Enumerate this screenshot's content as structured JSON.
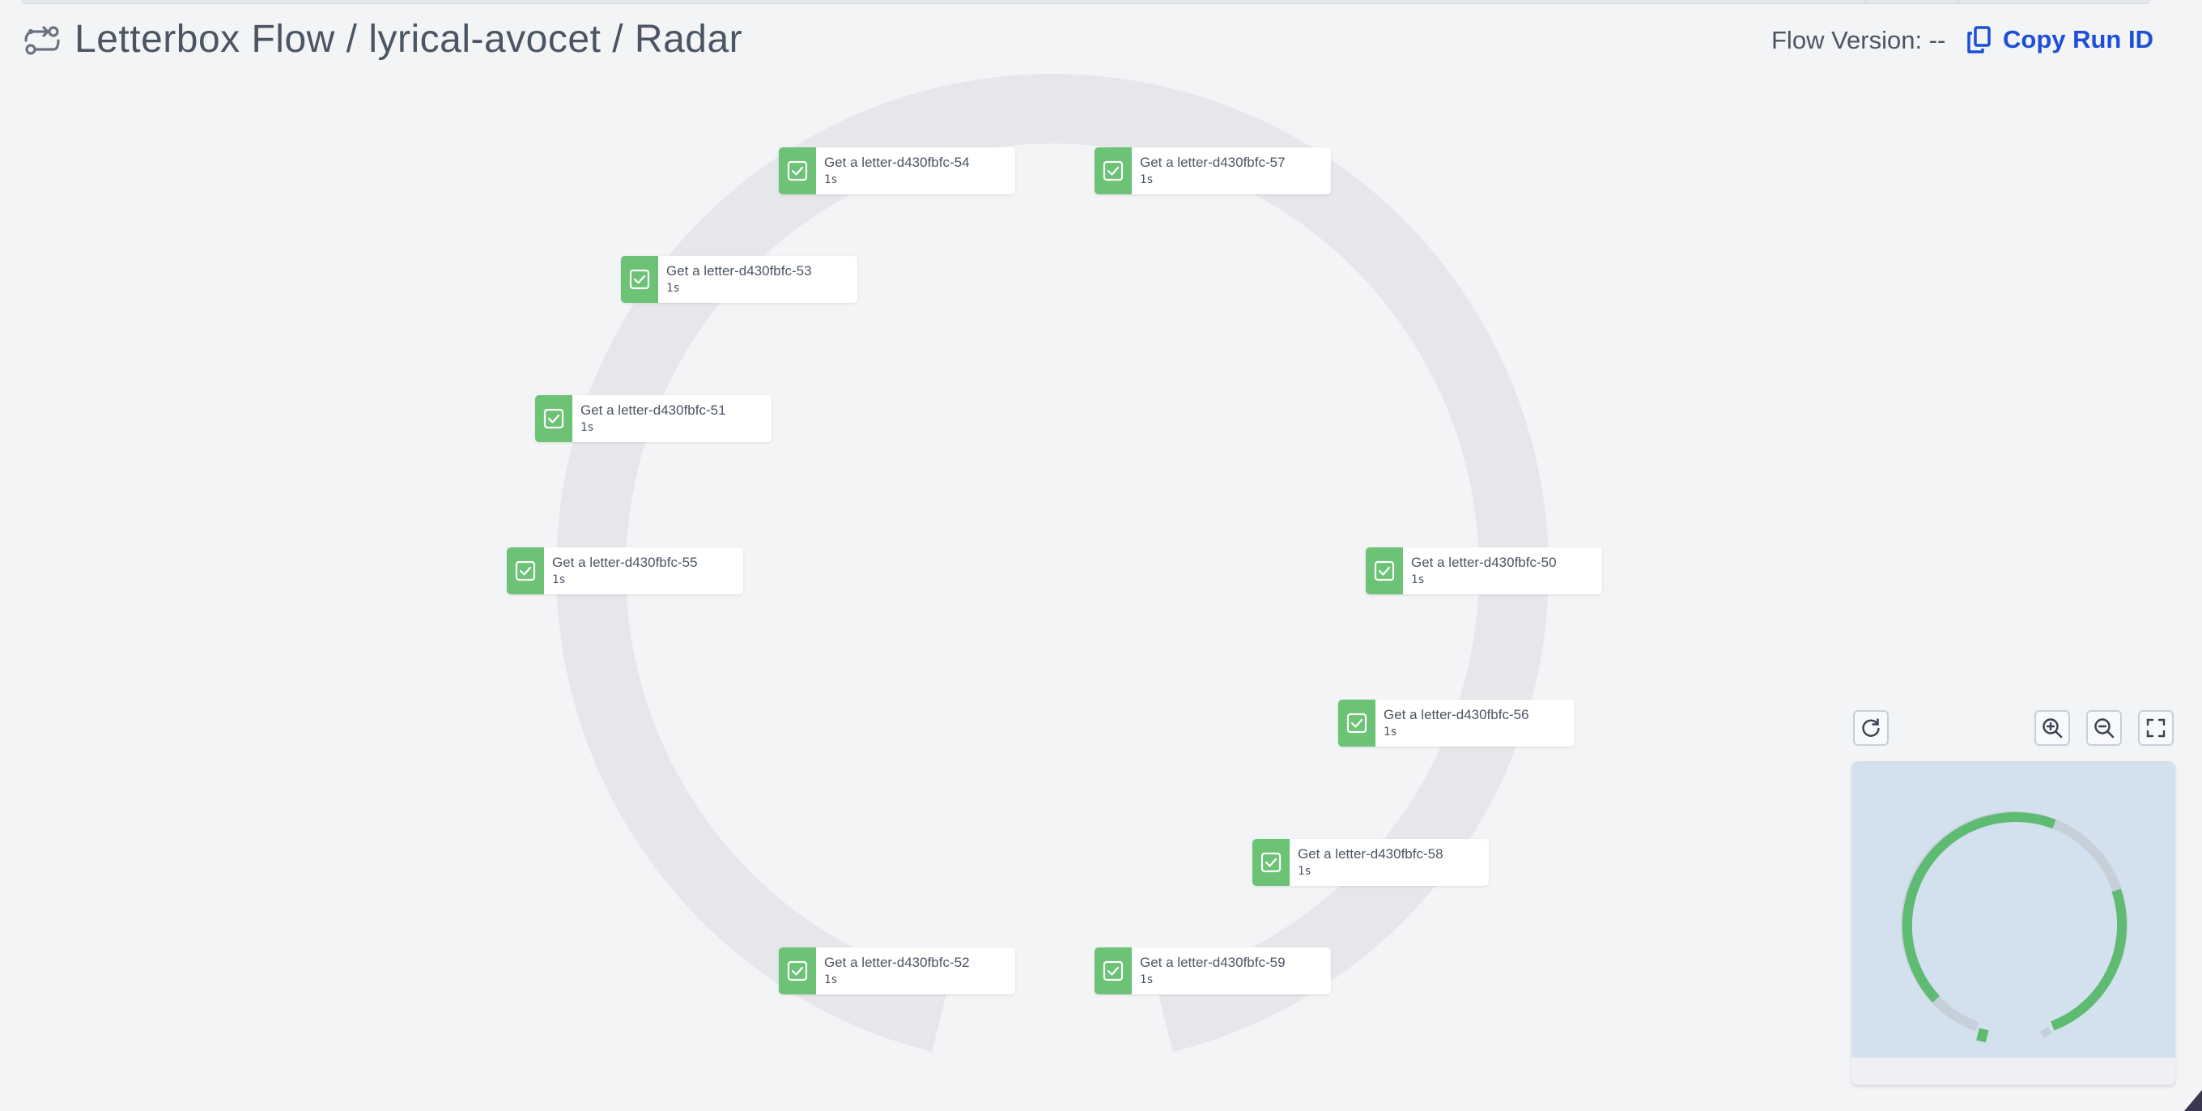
{
  "header": {
    "title": "Letterbox Flow / lyrical-avocet / Radar",
    "flow_version_label": "Flow Version:",
    "flow_version_value": "--",
    "copy_run_id_label": "Copy Run ID",
    "title_icon": "flow-icon",
    "copy_icon": "copy-icon"
  },
  "nodes": [
    {
      "name": "Get a letter-d430fbfc-54",
      "duration": "1s",
      "status": "success"
    },
    {
      "name": "Get a letter-d430fbfc-57",
      "duration": "1s",
      "status": "success"
    },
    {
      "name": "Get a letter-d430fbfc-53",
      "duration": "1s",
      "status": "success"
    },
    {
      "name": "Get a letter-d430fbfc-51",
      "duration": "1s",
      "status": "success"
    },
    {
      "name": "Get a letter-d430fbfc-55",
      "duration": "1s",
      "status": "success"
    },
    {
      "name": "Get a letter-d430fbfc-50",
      "duration": "1s",
      "status": "success"
    },
    {
      "name": "Get a letter-d430fbfc-56",
      "duration": "1s",
      "status": "success"
    },
    {
      "name": "Get a letter-d430fbfc-58",
      "duration": "1s",
      "status": "success"
    },
    {
      "name": "Get a letter-d430fbfc-52",
      "duration": "1s",
      "status": "success"
    },
    {
      "name": "Get a letter-d430fbfc-59",
      "duration": "1s",
      "status": "success"
    }
  ],
  "controls": {
    "icons": [
      "reset-view-icon",
      "zoom-in-icon",
      "zoom-out-icon",
      "fullscreen-icon"
    ]
  },
  "colors": {
    "success": "#6cc275",
    "accent": "#1d4ed8",
    "background": "#f3f4f6",
    "minimap_viewport": "#d3e0ee"
  }
}
